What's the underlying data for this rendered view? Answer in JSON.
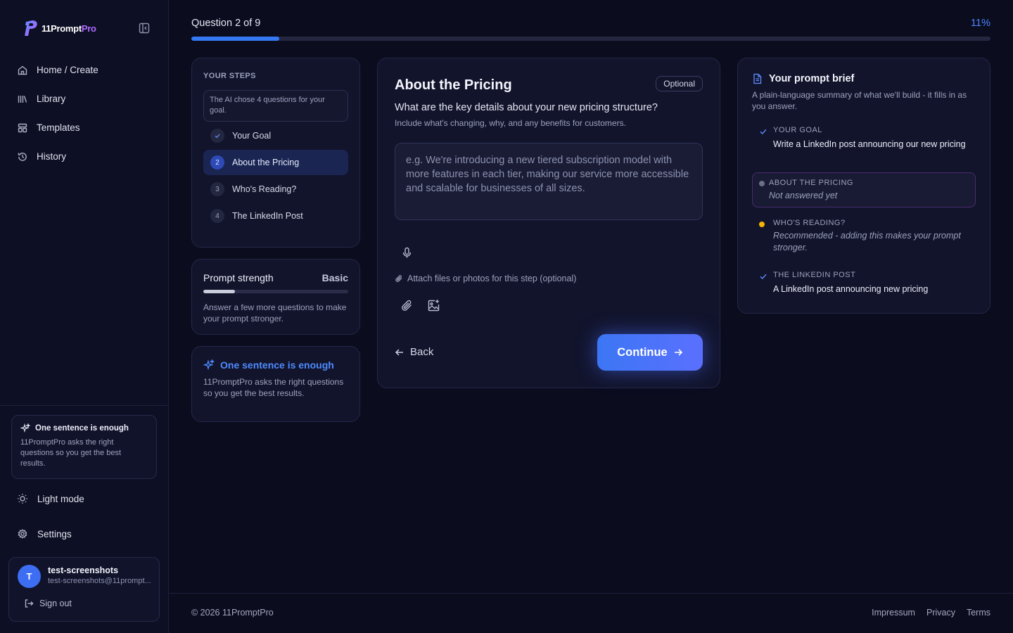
{
  "app": {
    "logo_name": "11Prompt",
    "logo_suffix": "Pro"
  },
  "sidebar": {
    "items": [
      {
        "label": "Home / Create",
        "icon": "home-icon"
      },
      {
        "label": "Library",
        "icon": "library-icon"
      },
      {
        "label": "Templates",
        "icon": "templates-icon"
      },
      {
        "label": "History",
        "icon": "history-icon"
      }
    ],
    "tip": {
      "title": "One sentence is enough",
      "body": "11PromptPro asks the right questions so you get the best results."
    },
    "light_mode_label": "Light mode",
    "settings_label": "Settings",
    "user": {
      "initial": "T",
      "name": "test-screenshots",
      "email": "test-screenshots@11prompt...",
      "signout_label": "Sign out"
    }
  },
  "progress": {
    "counter_text": "Question 2 of 9",
    "percent_text": "11%",
    "fraction": 0.11
  },
  "steps": {
    "title": "YOUR STEPS",
    "note": "The AI chose 4 questions for your goal.",
    "items": [
      {
        "num": "✓",
        "label": "Your Goal",
        "state": "done"
      },
      {
        "num": "2",
        "label": "About the Pricing",
        "state": "active"
      },
      {
        "num": "3",
        "label": "Who's Reading?",
        "state": "pending"
      },
      {
        "num": "4",
        "label": "The LinkedIn Post",
        "state": "pending"
      }
    ]
  },
  "strength": {
    "label": "Prompt strength",
    "level": "Basic",
    "fraction": 0.22,
    "text": "Answer a few more questions to make your prompt stronger."
  },
  "tip": {
    "title": "One sentence is enough",
    "body": "11PromptPro asks the right questions so you get the best results."
  },
  "main": {
    "title": "About the Pricing",
    "badge": "Optional",
    "question": "What are the key details about your new pricing structure?",
    "hint": "Include what's changing, why, and any benefits for customers.",
    "answer_value": "",
    "answer_placeholder": "e.g. We're introducing a new tiered subscription model with more features in each tier, making our service more accessible and scalable for businesses of all sizes.",
    "attach_label": "Attach files or photos for this step (optional)",
    "back_label": "Back",
    "continue_label": "Continue"
  },
  "brief": {
    "title": "Your prompt brief",
    "subtitle": "A plain-language summary of what we'll build - it fills in as you answer.",
    "items": [
      {
        "label": "YOUR GOAL",
        "value": "Write a LinkedIn post announcing our new pricing",
        "status": "done"
      },
      {
        "label": "ABOUT THE PRICING",
        "value": "Not answered yet",
        "status": "current"
      },
      {
        "label": "WHO'S READING?",
        "value": "Recommended - adding this makes your prompt stronger.",
        "status": "recommended"
      },
      {
        "label": "THE LINKEDIN POST",
        "value": "A LinkedIn post announcing new pricing",
        "status": "done"
      }
    ]
  },
  "footer": {
    "copyright": "© 2026 11PromptPro",
    "links": [
      "Impressum",
      "Privacy",
      "Terms"
    ]
  },
  "colors": {
    "background": "#0b0c1e",
    "accent": "#3578f3",
    "logo_accent": "#b06cff",
    "recommended": "#f5b400"
  }
}
